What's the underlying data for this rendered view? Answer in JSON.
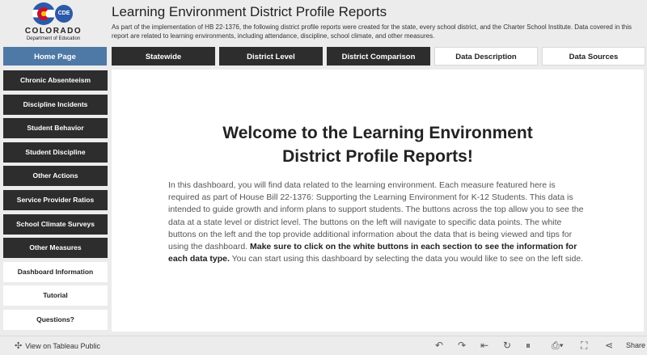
{
  "logo": {
    "name": "COLORADO",
    "sub": "Department of Education",
    "badge": "CDE"
  },
  "header": {
    "title": "Learning Environment District Profile Reports",
    "description": "As part of the implementation of HB 22-1376, the following district profile reports were created for the state, every school district, and the Charter School Institute. Data covered in this report are related to learning environments, including attendance, discipline, school climate, and other measures."
  },
  "nav": {
    "home": "Home Page",
    "top": [
      "Statewide",
      "District Level",
      "District Comparison",
      "Data Description",
      "Data Sources"
    ],
    "side": [
      "Chronic Absenteeism",
      "Discipline Incidents",
      "Student Behavior",
      "Student Discipline",
      "Other Actions",
      "Service Provider Ratios",
      "School Climate Surveys",
      "Other Measures",
      "Dashboard Information",
      "Tutorial",
      "Questions?"
    ]
  },
  "main": {
    "welcome_line1": "Welcome to the Learning Environment",
    "welcome_line2": "District Profile Reports!",
    "para1": "In this dashboard, you will find data related to the learning environment. Each measure featured here is required as part of House Bill 22-1376: Supporting the Learning Environment for K-12 Students. This data is intended to guide growth and inform plans to support students. The buttons across the top allow you to see the data at a state level or district level. The buttons on the left will navigate to specific data points. The white buttons on the left and the top provide additional information about the data that is being viewed and tips for using the dashboard.",
    "para_bold": "Make sure to click on the white buttons in each section to see the information for each data type.",
    "para2": "You can start using this dashboard by selecting the data you would like to see on the left side."
  },
  "footer": {
    "view_on": "View on Tableau Public",
    "share": "Share"
  },
  "colors": {
    "home": "#4e79a7",
    "dark_button": "#2d2d2d",
    "white_button": "#ffffff"
  }
}
